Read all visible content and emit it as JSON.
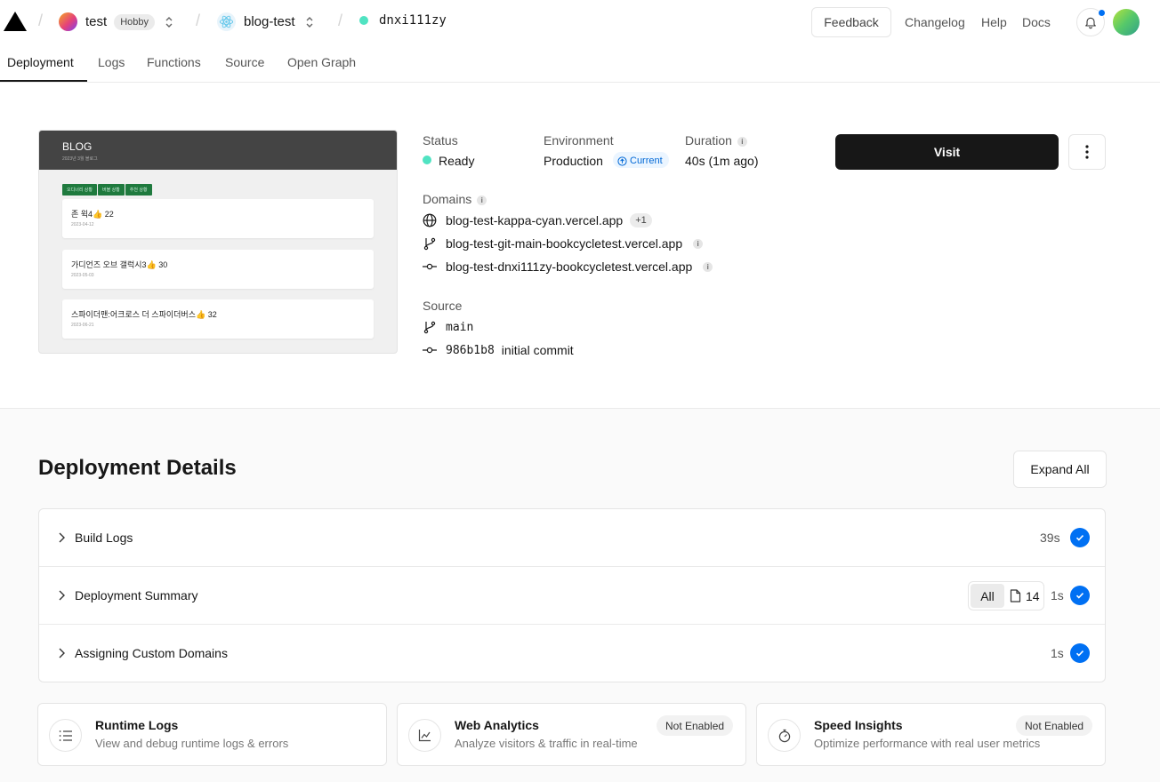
{
  "header": {
    "team_name": "test",
    "plan": "Hobby",
    "project_name": "blog-test",
    "deployment_id": "dnxi111zy",
    "feedback_label": "Feedback",
    "links": [
      "Changelog",
      "Help",
      "Docs"
    ],
    "notification_color": "#0070f3"
  },
  "tabs": [
    "Deployment",
    "Logs",
    "Functions",
    "Source",
    "Open Graph"
  ],
  "preview": {
    "blog_title": "BLOG",
    "blog_subtitle": "2023년 3월 블로그",
    "chips": [
      "오디너리 상황",
      "버블 상황",
      "추천 상황"
    ],
    "posts": [
      {
        "title": "존 윅4👍 22",
        "date": "2023-04-12"
      },
      {
        "title": "가디언즈 오브 갤럭시3👍 30",
        "date": "2023-05-03"
      },
      {
        "title": "스파이더맨:어크로스 더 스파이더버스👍 32",
        "date": "2023-06-21"
      }
    ]
  },
  "info": {
    "status_label": "Status",
    "status_value": "Ready",
    "status_color": "#50e3c2",
    "environment_label": "Environment",
    "environment_value": "Production",
    "current_badge": "Current",
    "duration_label": "Duration",
    "duration_value": "40s (1m ago)",
    "domains_label": "Domains",
    "domains": [
      {
        "text": "blog-test-kappa-cyan.vercel.app",
        "icon": "globe-icon",
        "extra": "+1"
      },
      {
        "text": "blog-test-git-main-bookcycletest.vercel.app",
        "icon": "git-branch-icon"
      },
      {
        "text": "blog-test-dnxi111zy-bookcycletest.vercel.app",
        "icon": "git-commit-icon"
      }
    ],
    "source_label": "Source",
    "branch": "main",
    "commit_hash": "986b1b8",
    "commit_message": "initial commit"
  },
  "actions": {
    "visit_label": "Visit"
  },
  "details": {
    "title": "Deployment Details",
    "expand_label": "Expand All",
    "rows": [
      {
        "label": "Build Logs",
        "time": "39s"
      },
      {
        "label": "Deployment Summary",
        "time": "1s",
        "filter_all": "All",
        "file_count": "14"
      },
      {
        "label": "Assigning Custom Domains",
        "time": "1s"
      }
    ],
    "check_color": "#0070f3"
  },
  "cards": [
    {
      "title": "Runtime Logs",
      "sub": "View and debug runtime logs & errors",
      "icon": "list-icon"
    },
    {
      "title": "Web Analytics",
      "sub": "Analyze visitors & traffic in real-time",
      "badge": "Not Enabled",
      "icon": "chart-icon"
    },
    {
      "title": "Speed Insights",
      "sub": "Optimize performance with real user metrics",
      "badge": "Not Enabled",
      "icon": "gauge-icon"
    }
  ]
}
